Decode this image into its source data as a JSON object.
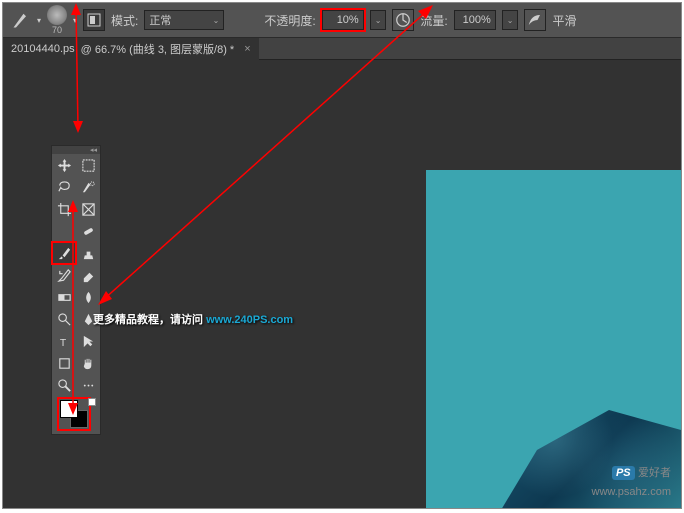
{
  "optbar": {
    "brush_size": "70",
    "mode_label": "模式:",
    "mode_value": "正常",
    "opacity_label": "不透明度:",
    "opacity_value": "10%",
    "flow_label": "流量:",
    "flow_value": "100%",
    "smoothing_label": "平滑"
  },
  "tab": {
    "filename": "20104440.ps",
    "zoom_doc": "@ 66.7% (曲线 3, 图层蒙版/8) *"
  },
  "watermark": {
    "text_cn": "更多精品教程，请访问 ",
    "url": "www.240PS.com",
    "logo_ps": "PS",
    "logo_txt": "爱好者",
    "footer_url": "www.psahz.com"
  },
  "tools": {
    "move": "move-tool",
    "marquee": "marquee-tool",
    "lasso": "lasso-tool",
    "wand": "magic-wand-tool",
    "crop": "crop-tool",
    "frame": "frame-tool",
    "eyedrop": "eyedropper-tool",
    "heal": "healing-tool",
    "brush": "brush-tool",
    "stamp": "clone-stamp-tool",
    "history": "history-brush-tool",
    "eraser": "eraser-tool",
    "gradient": "gradient-tool",
    "blur": "blur-tool",
    "dodge": "dodge-tool",
    "pen": "pen-tool",
    "type": "type-tool",
    "path": "path-select-tool",
    "shape": "shape-tool",
    "hand": "hand-tool",
    "zoom": "zoom-tool",
    "more": "more-tools"
  }
}
